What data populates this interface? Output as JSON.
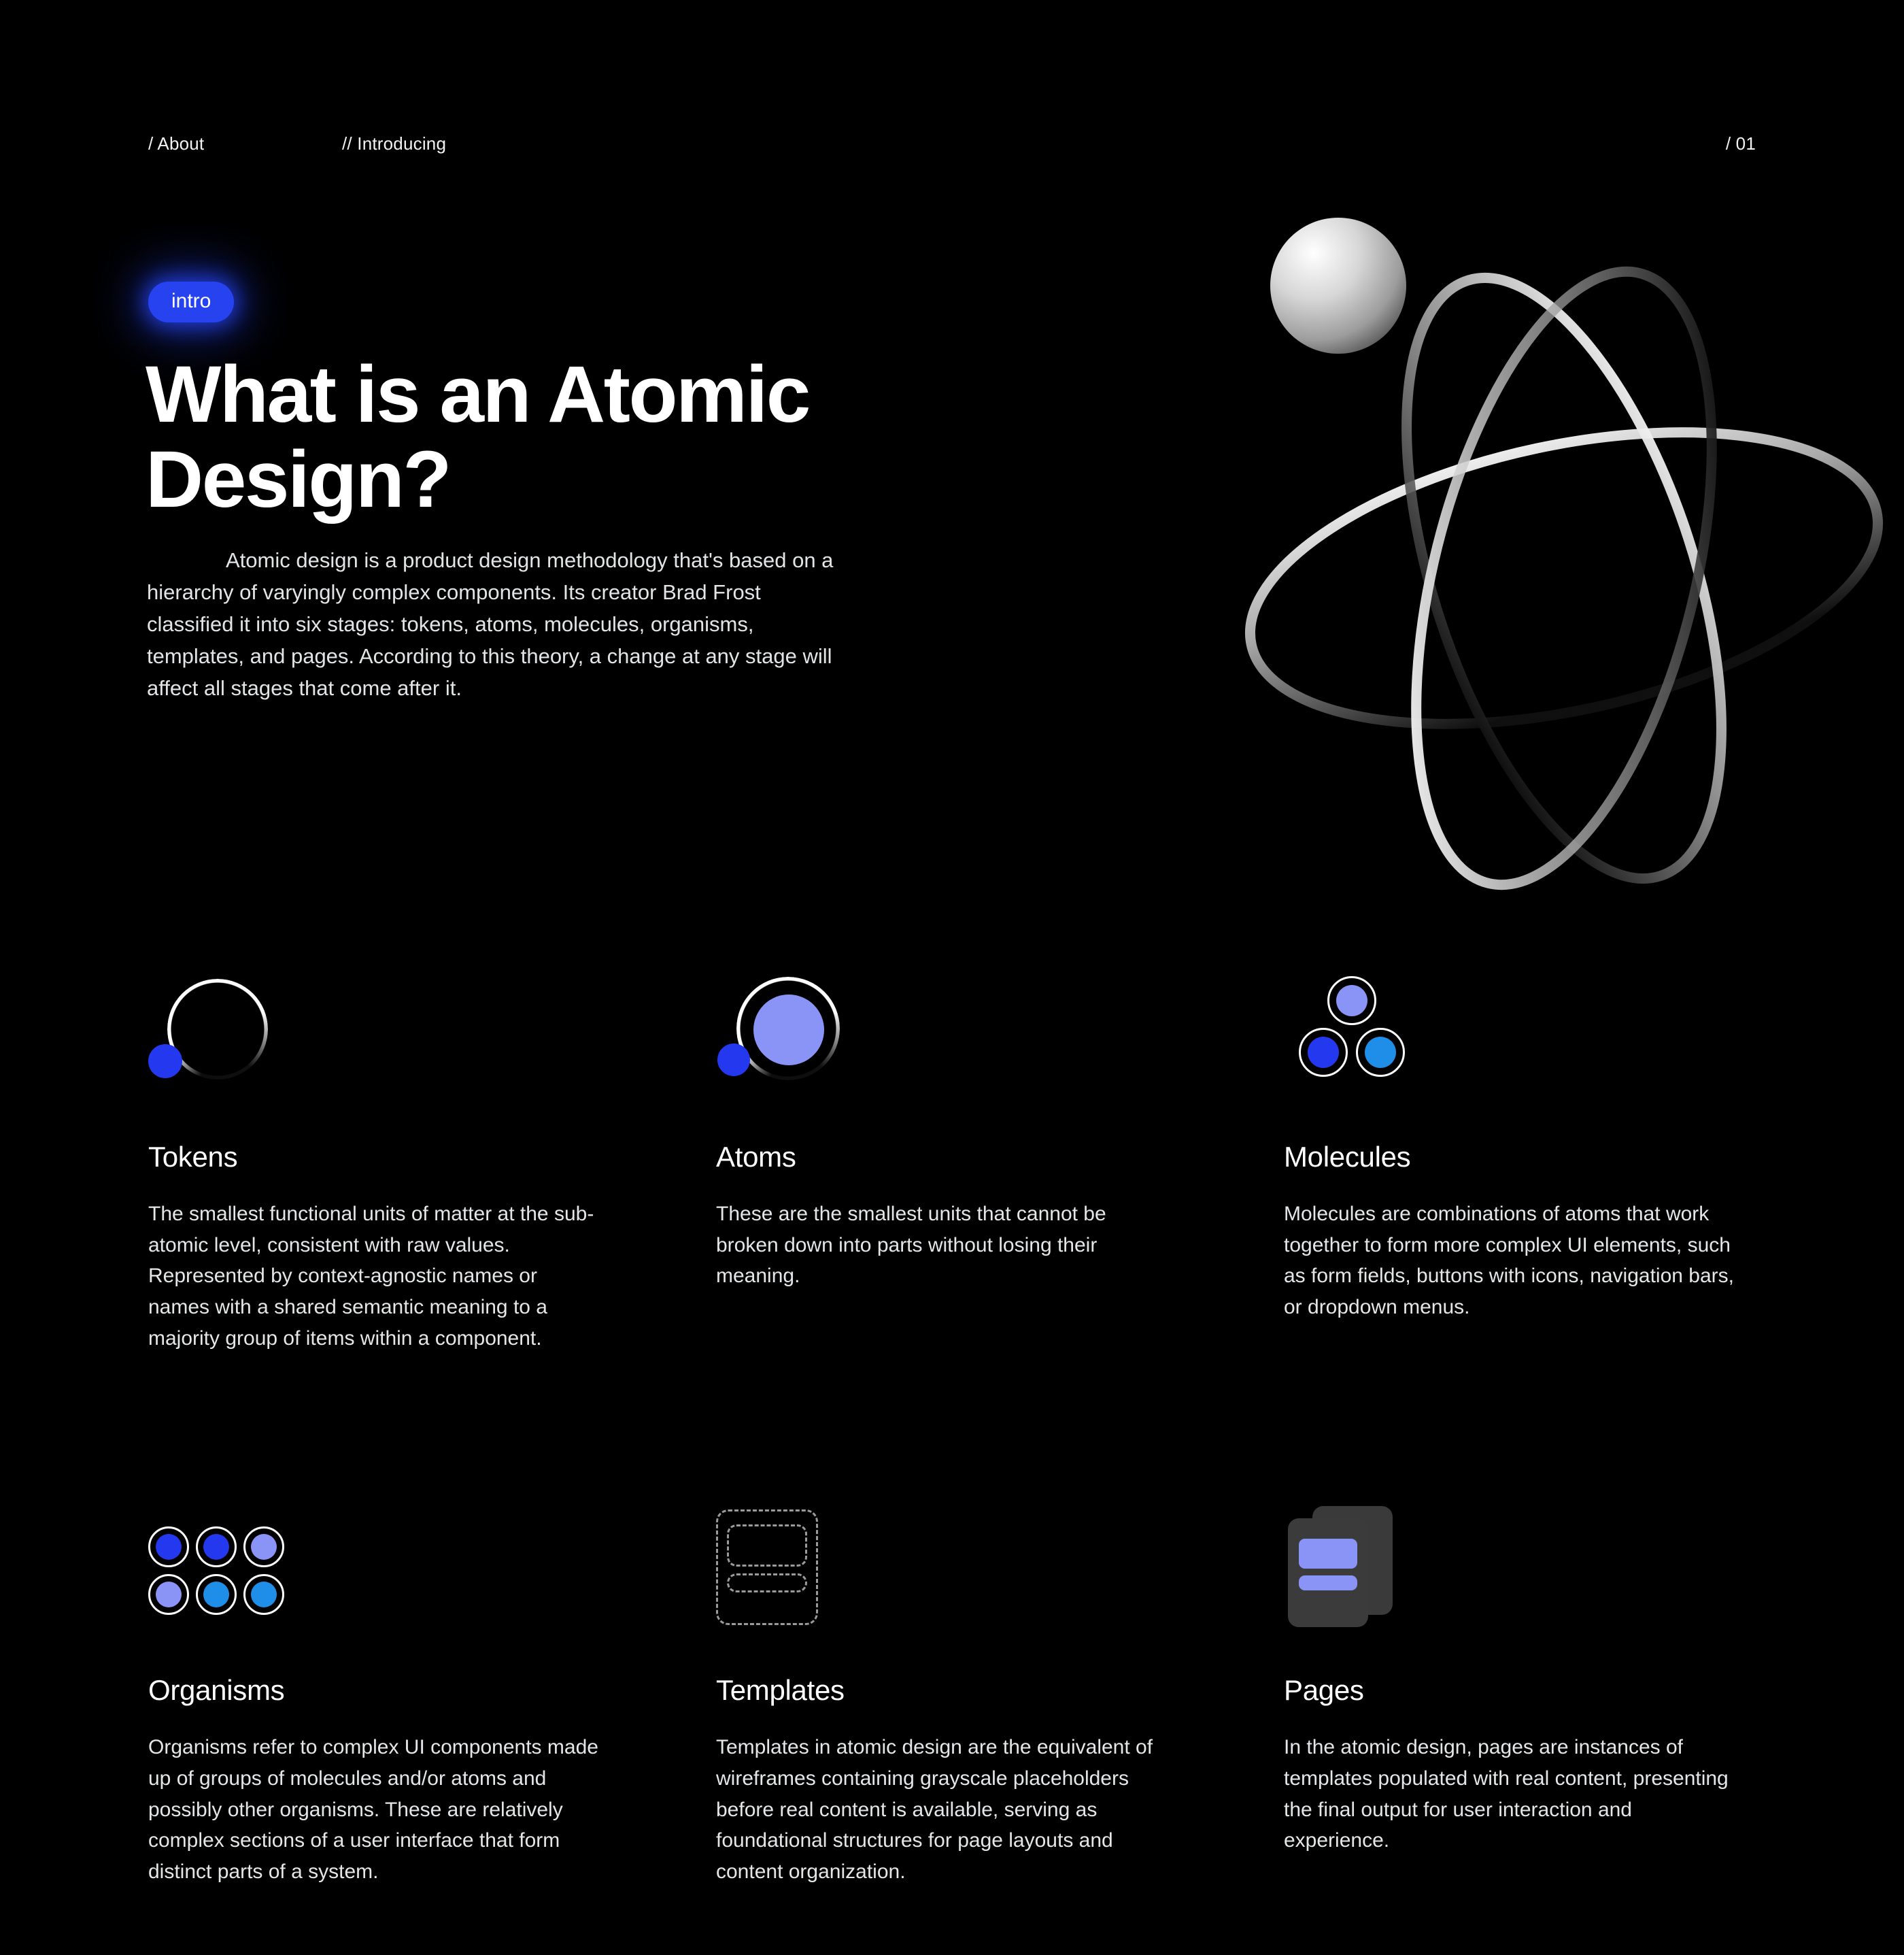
{
  "topbar": {
    "section_label": "/ About",
    "subsection_label": "// Introducing",
    "page_number": "/ 01"
  },
  "hero": {
    "badge_label": "intro",
    "title": "What is an Atomic Design?",
    "paragraph": "Atomic design is a product design methodology that's based on a hierarchy of varyingly complex components. Its creator Brad Frost classified it into six stages: tokens, atoms, molecules, organisms, templates, and pages. According to this theory, a change at any stage will affect all stages that come after it."
  },
  "illustration": {
    "name": "atom-illustration",
    "nucleus_electron": "sphere",
    "orbit_count": 3
  },
  "colors": {
    "background": "#000000",
    "accent_blue": "#2743f0",
    "dot_blue": "#2438ef",
    "periwinkle": "#8a93f6",
    "cyan_blue": "#1e8ee8",
    "ring_white": "#ffffff",
    "paper_gray": "#3b3b3b",
    "dashed_gray": "#9a9a9a",
    "body_text": "#e4e6e8"
  },
  "cards": [
    {
      "icon": "tokens-icon",
      "title": "Tokens",
      "body": "The smallest functional units of matter at the sub-atomic level, consistent with raw values. Represented by context-agnostic names or names with a shared semantic meaning to a majority group of items within a component."
    },
    {
      "icon": "atoms-icon",
      "title": "Atoms",
      "body": "These are the smallest units that cannot be broken down into parts without losing their meaning."
    },
    {
      "icon": "molecules-icon",
      "title": "Molecules",
      "body": "Molecules are combinations of atoms that work together to form more complex UI elements, such as form fields, buttons with icons, navigation bars, or dropdown menus."
    },
    {
      "icon": "organisms-icon",
      "title": "Organisms",
      "body": "Organisms refer to complex UI components made up of groups of molecules and/or atoms and possibly other organisms. These are relatively complex sections of a user interface that form distinct parts of a system."
    },
    {
      "icon": "templates-icon",
      "title": "Templates",
      "body": "Templates in atomic design are the equivalent of wireframes containing grayscale placeholders before real content is available, serving as foundational structures for page layouts and content organization."
    },
    {
      "icon": "pages-icon",
      "title": "Pages",
      "body": "In the atomic design, pages are instances of templates populated with real content, presenting the final output for user interaction and experience."
    }
  ]
}
